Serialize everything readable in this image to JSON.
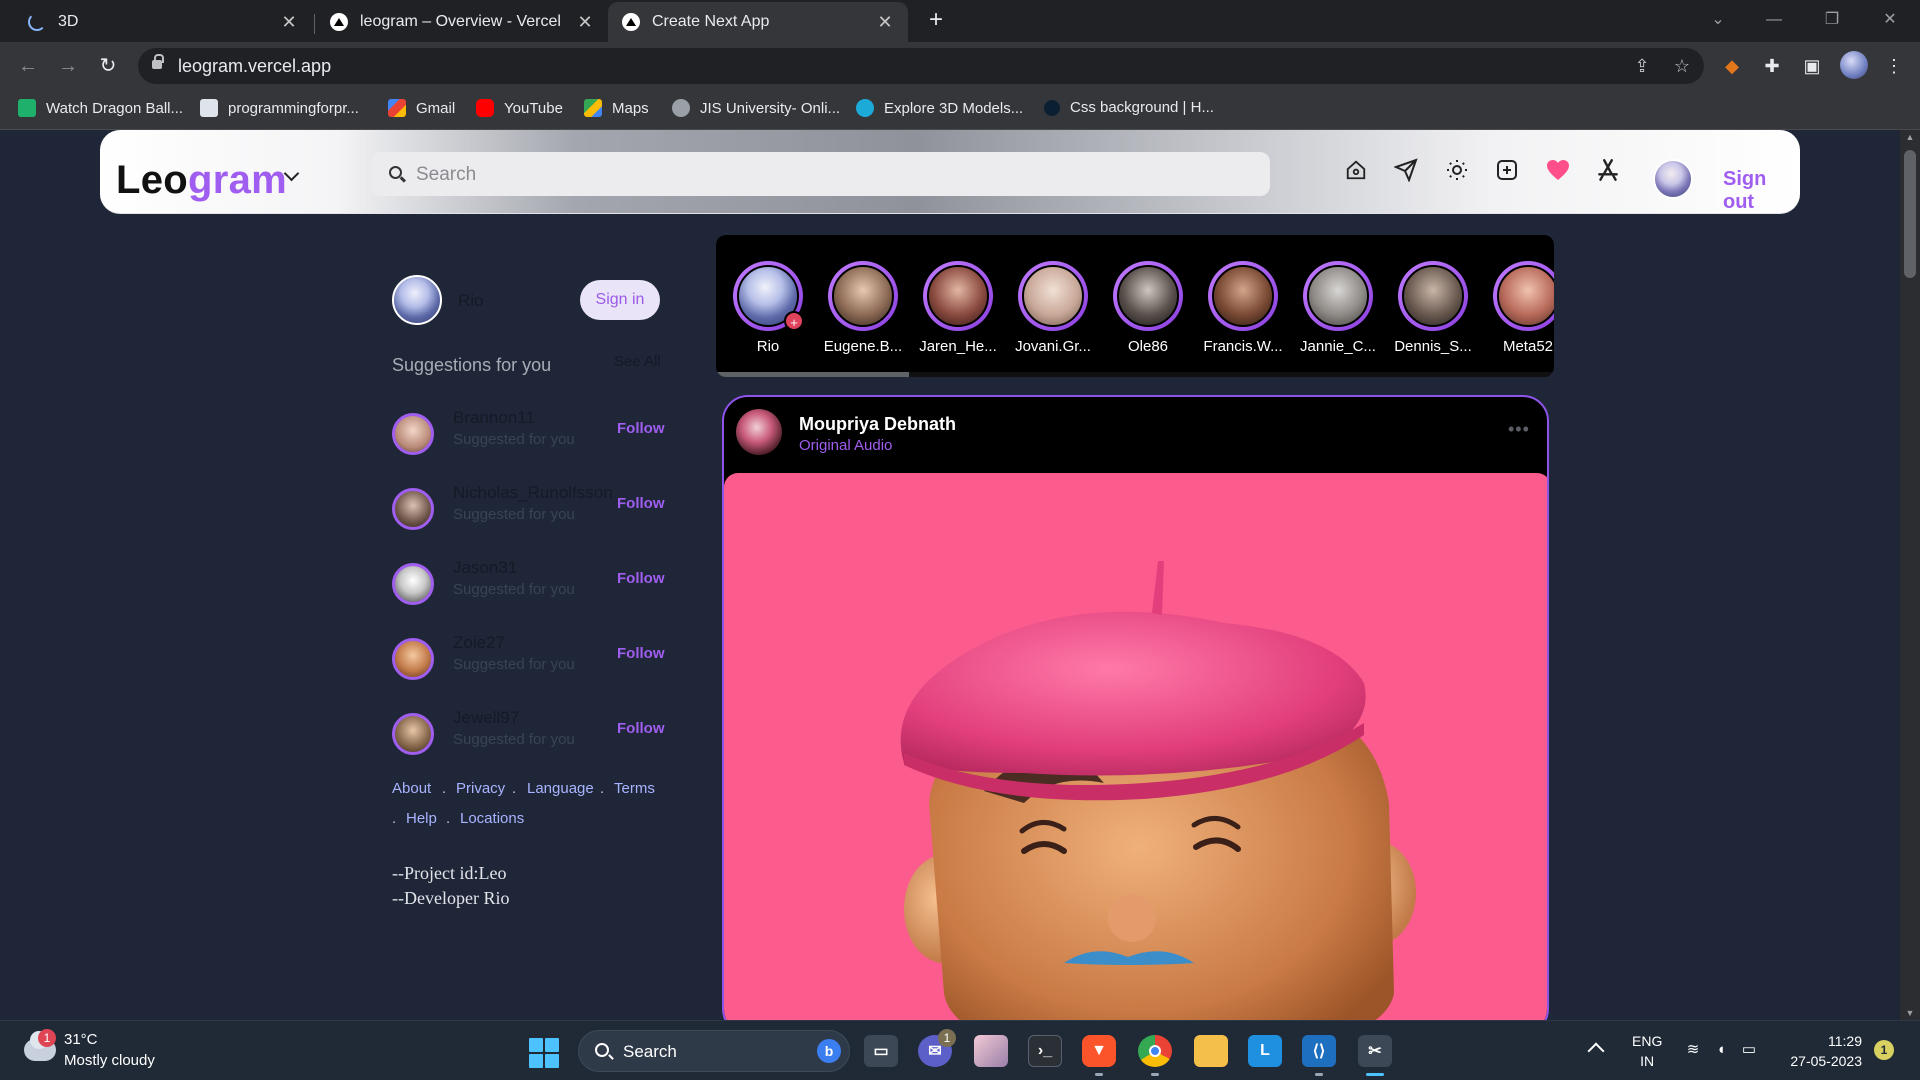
{
  "browser": {
    "tabs": [
      {
        "title": "3D",
        "icon": "loading-spinner-icon",
        "close": "✕"
      },
      {
        "title": "leogram – Overview - Vercel",
        "icon": "vercel-icon",
        "close": "✕"
      },
      {
        "title": "Create Next App",
        "icon": "nextjs-icon",
        "close": "✕"
      }
    ],
    "new_tab": "+",
    "url": "leogram.vercel.app",
    "bookmarks": [
      {
        "label": "Watch Dragon Ball...",
        "icon": "tv-icon",
        "color": "#1fb06b"
      },
      {
        "label": "programmingforpr...",
        "icon": "page-icon",
        "color": "#dfe3ea"
      },
      {
        "label": "Gmail",
        "icon": "gmail-icon",
        "color": "#ea4335"
      },
      {
        "label": "YouTube",
        "icon": "youtube-icon",
        "color": "#ff0000"
      },
      {
        "label": "Maps",
        "icon": "maps-icon",
        "color": "#34a853"
      },
      {
        "label": "JIS University- Onli...",
        "icon": "globe-icon",
        "color": "#9aa0a6"
      },
      {
        "label": "Explore 3D Models...",
        "icon": "sketchfab-icon",
        "color": "#1caad9"
      },
      {
        "label": "Css background | H...",
        "icon": "dark-circle-icon",
        "color": "#0b1f33"
      }
    ]
  },
  "app": {
    "logo_main": "Leo",
    "logo_accent": "gram",
    "search_placeholder": "Search",
    "sign_out": "Sign out",
    "accent_color": "#a05ef0"
  },
  "sidebar": {
    "user_name": "Rio",
    "sign_in": "Sign in",
    "suggestions_title": "Suggestions for you",
    "see_all": "See All",
    "suggestions": [
      {
        "username": "Brannon11",
        "sub": "Suggested for you",
        "action": "Follow"
      },
      {
        "username": "Nicholas_Runolfsson",
        "sub": "Suggested for you",
        "action": "Follow"
      },
      {
        "username": "Jason31",
        "sub": "Suggested for you",
        "action": "Follow"
      },
      {
        "username": "Zoie27",
        "sub": "Suggested for you",
        "action": "Follow"
      },
      {
        "username": "Jewell97",
        "sub": "Suggested for you",
        "action": "Follow"
      }
    ],
    "footer_links": [
      "About",
      "Privacy",
      "Language",
      "Terms",
      "Help",
      "Locations"
    ],
    "footer_sep": ".",
    "credits": [
      "--Project id:Leo",
      "--Developer Rio"
    ]
  },
  "stories": [
    {
      "name": "Rio",
      "badge": "+"
    },
    {
      "name": "Eugene.B..."
    },
    {
      "name": "Jaren_He..."
    },
    {
      "name": "Jovani.Gr..."
    },
    {
      "name": "Ole86"
    },
    {
      "name": "Francis.W..."
    },
    {
      "name": "Jannie_C..."
    },
    {
      "name": "Dennis_S..."
    },
    {
      "name": "Meta52"
    }
  ],
  "stories_scroll_progress": 0.23,
  "post": {
    "author": "Moupriya Debnath",
    "audio": "Original Audio",
    "more": "•••",
    "media_color": "#fc5b8d"
  },
  "taskbar": {
    "weather_temp": "31°C",
    "weather_condition": "Mostly cloudy",
    "weather_badge": "1",
    "search_label": "Search",
    "bing_label": "b",
    "teams_badge": "1",
    "lang_line1": "ENG",
    "lang_line2": "IN",
    "time": "11:29",
    "date": "27-05-2023",
    "notifications": "1"
  }
}
